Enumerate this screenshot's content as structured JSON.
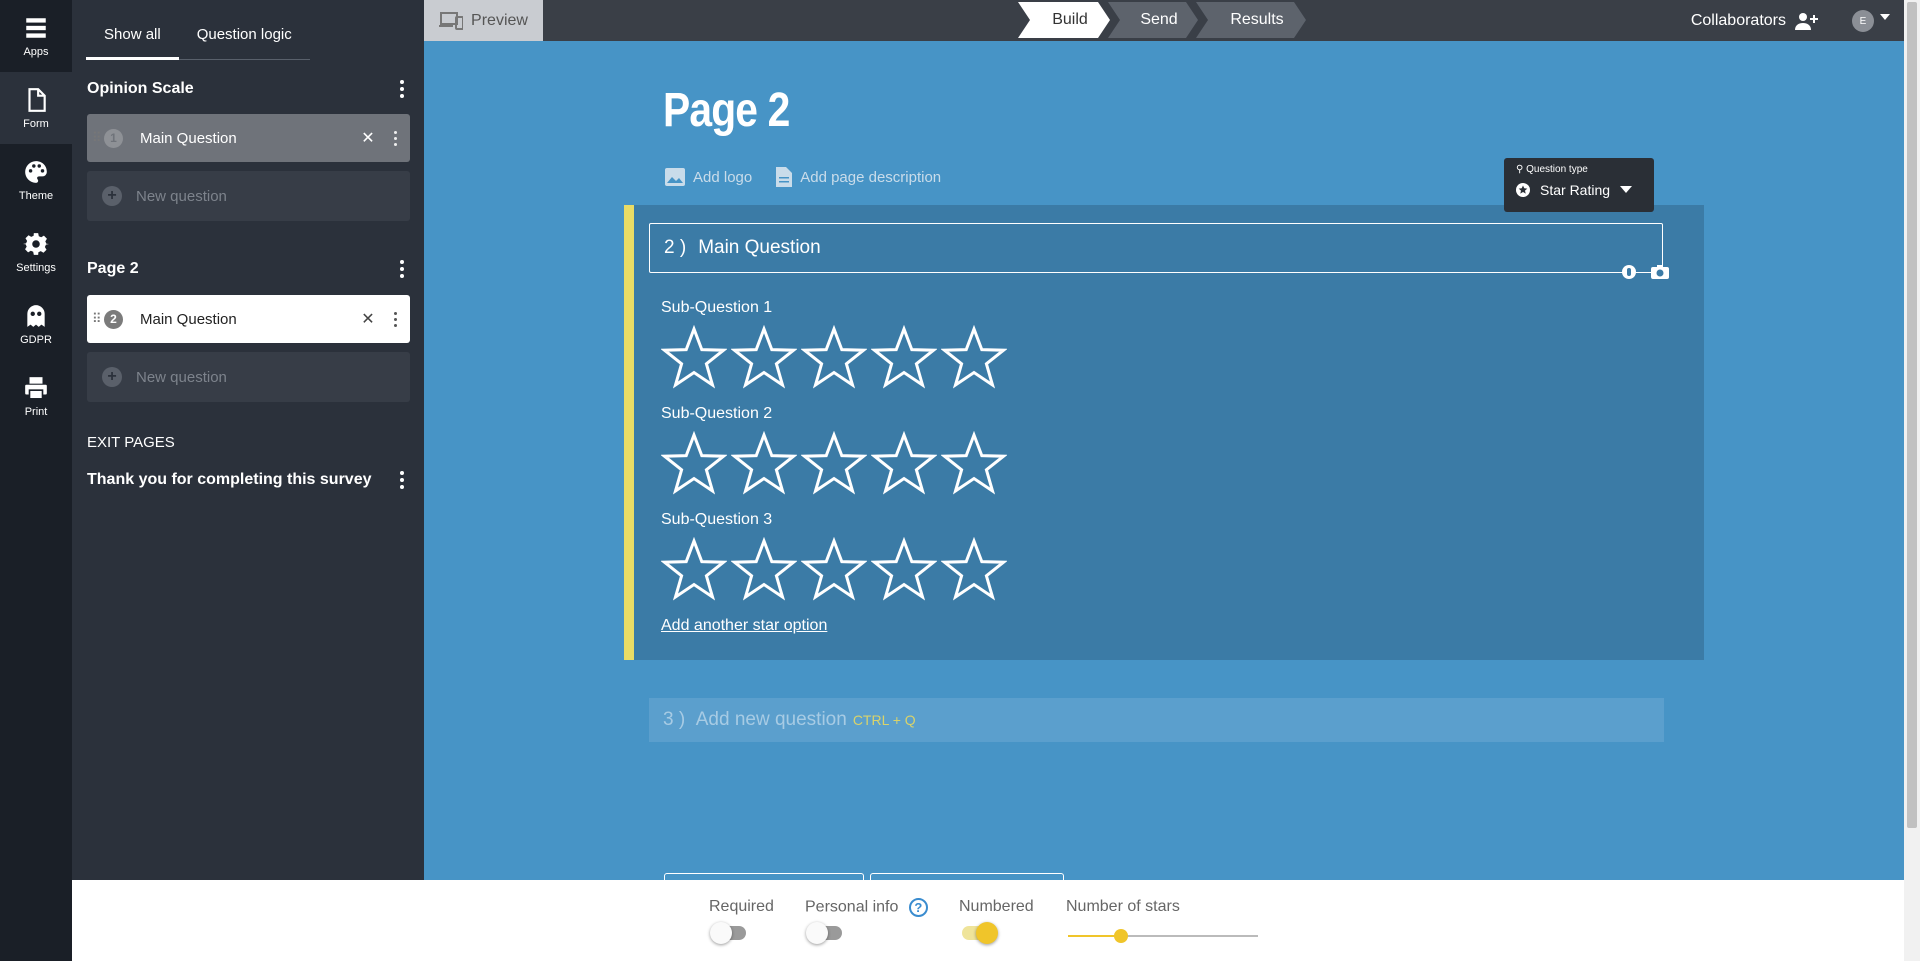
{
  "rail": {
    "items": [
      {
        "label": "Apps",
        "icon": "apps-icon"
      },
      {
        "label": "Form",
        "icon": "form-icon"
      },
      {
        "label": "Theme",
        "icon": "palette-icon"
      },
      {
        "label": "Settings",
        "icon": "gear-icon"
      },
      {
        "label": "GDPR",
        "icon": "ghost-icon"
      },
      {
        "label": "Print",
        "icon": "printer-icon"
      }
    ]
  },
  "sidebar": {
    "tabs": [
      "Show all",
      "Question logic"
    ],
    "sections": [
      {
        "title": "Opinion Scale",
        "question": {
          "number": "1",
          "title": "Main Question"
        },
        "new_label": "New question"
      },
      {
        "title": "Page 2",
        "question": {
          "number": "2",
          "title": "Main Question"
        },
        "new_label": "New question"
      }
    ],
    "exit_label": "EXIT PAGES",
    "exit_page_title": "Thank you for completing this survey"
  },
  "topbar": {
    "preview_label": "Preview",
    "crumbs": [
      "Build",
      "Send",
      "Results"
    ],
    "collaborators_label": "Collaborators",
    "avatar_initial": "E"
  },
  "page": {
    "title": "Page 2",
    "add_logo": "Add logo",
    "add_description": "Add page description"
  },
  "question": {
    "number": "2 )",
    "title": "Main Question",
    "type_label": "Question type",
    "type_value": "Star Rating",
    "sub_questions": [
      "Sub-Question 1",
      "Sub-Question 2",
      "Sub-Question 3"
    ],
    "stars_per_row": 5,
    "add_star_option": "Add another star option"
  },
  "new_question_bar": {
    "number": "3 )",
    "label": "Add new question",
    "shortcut": "CTRL + Q"
  },
  "bottombar": {
    "required_label": "Required",
    "personal_info_label": "Personal info",
    "numbered_label": "Numbered",
    "number_of_stars_label": "Number of stars",
    "required_on": false,
    "personal_info_on": false,
    "numbered_on": true,
    "number_of_stars_fraction": 0.28
  },
  "colors": {
    "canvas_bg": "#4794c6",
    "card_bg": "#3b7ba6",
    "accent_yellow": "#f0c52a",
    "sidebar_bg": "#2b313b"
  }
}
